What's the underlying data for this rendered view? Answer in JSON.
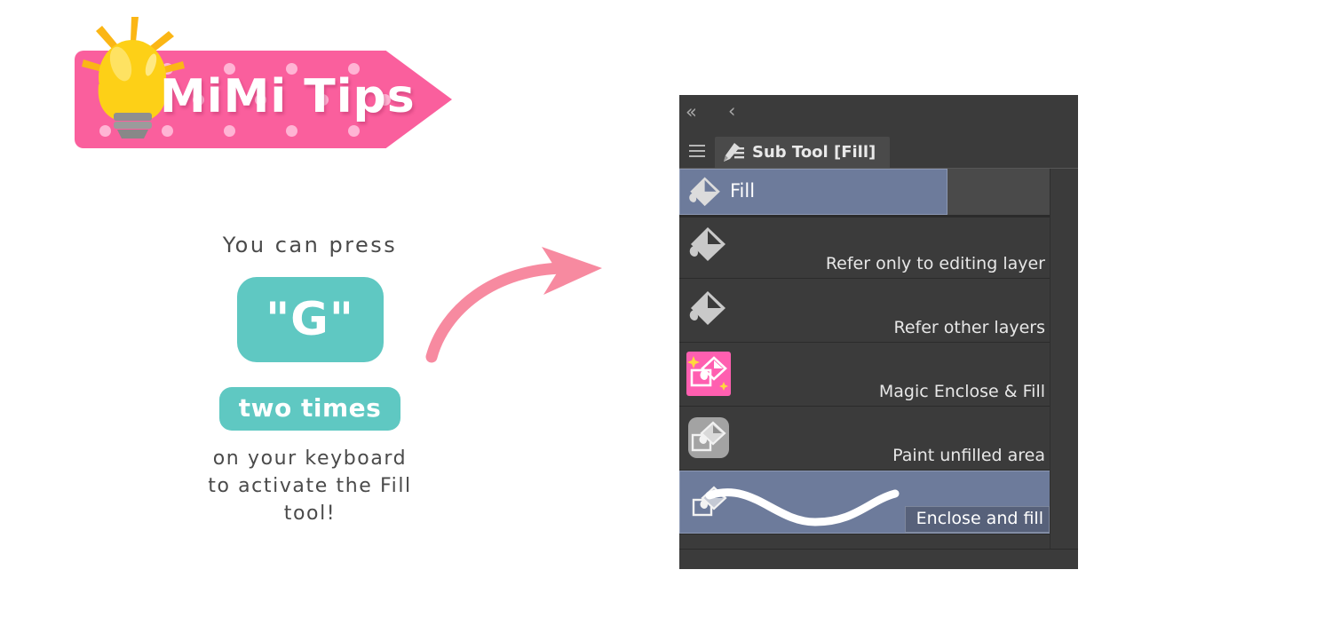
{
  "colors": {
    "page_background": "#ffffff",
    "brand_pink": "#fa5f9d",
    "brand_pink_dots": "#ffb4d4",
    "accent_teal": "#5fc8c2",
    "arrow_pink": "#f78aa0",
    "panel_background": "#3b3b3b",
    "panel_tab": "#4a4a4a",
    "selection_blue": "#6d7b9b",
    "bulb_yellow": "#fbc916",
    "magic_badge_pink": "#ff5fb0",
    "body_text": "#4a4a4a"
  },
  "logo": {
    "title": "MiMi Tips",
    "bulb_icon": "lightbulb-icon"
  },
  "tip": {
    "intro_line": "You can press",
    "key_label": "\"G\"",
    "repeat_label": "two times",
    "closing_line": "on your keyboard\nto activate the Fill\ntool!"
  },
  "arrow": {
    "icon": "curved-arrow-icon",
    "direction": "right"
  },
  "panel": {
    "topbar": {
      "collapse_all_icon": "«",
      "collapse_one_icon": "‹"
    },
    "menu_icon": "hamburger-menu-icon",
    "tab": {
      "label": "Sub Tool [Fill]",
      "icon": "sub-tool-pencil-icon"
    },
    "tools": [
      {
        "label": "Fill",
        "icon": "paint-bucket-icon",
        "selected": true,
        "label_position": "left"
      },
      {
        "label": "Refer only to editing layer",
        "icon": "paint-bucket-icon",
        "selected": false,
        "label_position": "right"
      },
      {
        "label": "Refer other layers",
        "icon": "paint-bucket-icon",
        "selected": false,
        "label_position": "right"
      },
      {
        "label": "Magic Enclose & Fill",
        "icon": "magic-enclose-fill-icon",
        "selected": false,
        "label_position": "right"
      },
      {
        "label": "Paint unfilled area",
        "icon": "paint-unfilled-area-icon",
        "selected": false,
        "label_position": "right"
      },
      {
        "label": "Enclose and fill",
        "icon": "enclose-and-fill-icon",
        "selected": true,
        "label_position": "right",
        "tooltip": true
      }
    ]
  }
}
